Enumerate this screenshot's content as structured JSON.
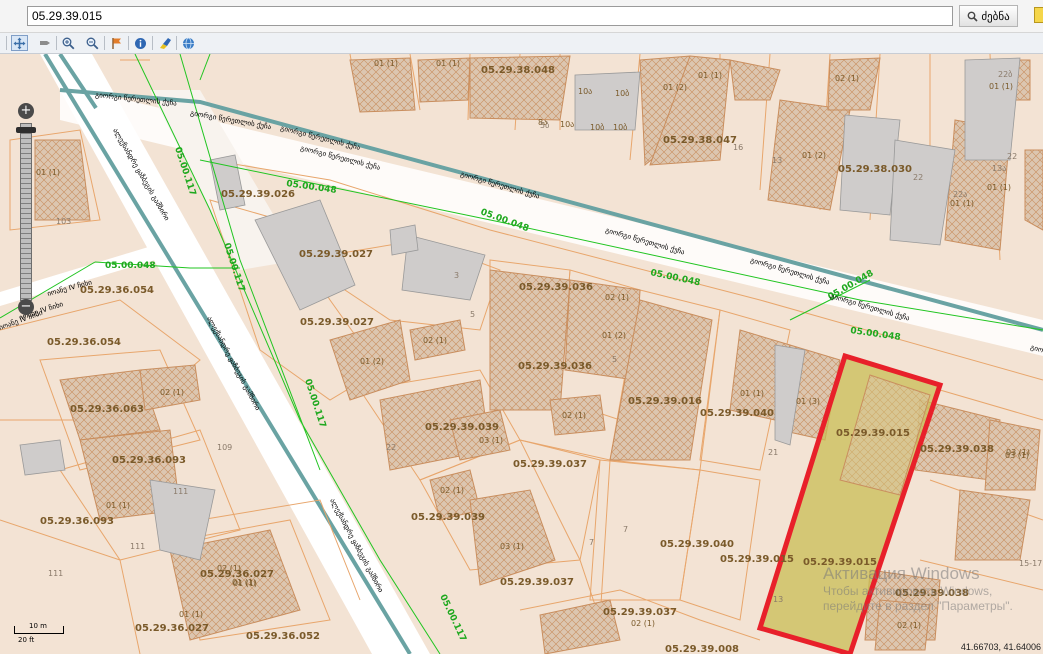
{
  "search": {
    "value": "05.29.39.015",
    "button_label": "ძებნა"
  },
  "map": {
    "parcels": [
      "05.29.38.048",
      "05.29.38.047",
      "05.29.38.030",
      "05.29.39.026",
      "05.29.39.027",
      "05.29.39.027",
      "05.29.39.036",
      "05.29.39.036",
      "05.29.39.016",
      "05.29.39.040",
      "05.29.39.015",
      "05.29.39.038",
      "05.29.39.039",
      "05.29.39.039",
      "05.29.39.037",
      "05.29.39.037",
      "05.29.39.040",
      "05.29.39.015",
      "05.29.39.015",
      "05.29.39.038",
      "05.29.39.037",
      "05.29.39.008",
      "05.29.36.054",
      "05.29.36.054",
      "05.29.36.063",
      "05.29.36.093",
      "05.29.36.093",
      "05.29.36.027",
      "05.29.36.027",
      "05.29.36.052"
    ],
    "buildings": [
      "01 (1)",
      "01 (1)",
      "10ა",
      "10ბ",
      "10ბ",
      "10ბ",
      "8ა",
      "10ა",
      "01 (2)",
      "01 (1)",
      "02 (1)",
      "01 (2)",
      "01 (1)",
      "01 (1)",
      "01 (1)",
      "01 (1)",
      "02 (1)",
      "01 (2)",
      "01 (2)",
      "02 (1)",
      "03 (1)",
      "02 (1)",
      "03 (1)",
      "01 (1)",
      "01 (3)",
      "03 (1)",
      "02 (1)",
      "01 (1)",
      "02 (1)",
      "01 (1)",
      "01 (1)",
      "01 (1)",
      "02 (1)",
      "02 (1)",
      "03 (1)",
      "02 (1)"
    ],
    "house_numbers": [
      "16",
      "13",
      "22",
      "22",
      "22ა",
      "22ბ",
      "103",
      "3",
      "5",
      "5",
      "7",
      "7",
      "13",
      "21",
      "22",
      "109",
      "111",
      "111",
      "111",
      "15-17",
      "5ბ",
      "13ა"
    ],
    "green_labels": [
      "05.00.117",
      "05.00.048",
      "05.00.048",
      "05.00.117",
      "05.00.048",
      "05.00.048",
      "05.00.048",
      "05.00.048",
      "05.00.117",
      "05.00.117"
    ],
    "street_labels": [
      "გიორგი წერეთლის ქუჩა",
      "გიორგი წერეთლის ქუჩა",
      "გიორგი წერეთლის ქუჩა",
      "გიორგი წერეთლის ქუჩა",
      "გიორგი წერეთლის ქუჩა",
      "გიორგი წერეთლის ქუჩა",
      "გიორგი წერეთლის ქუჩა",
      "გიორგი წერეთლის ქუჩა",
      "გიორგი წერეთლის ქუჩა",
      "ალექსანდრე ყაზბეგის გამზირი",
      "ალექსანდრე ყაზბეგის გამზირი",
      "ალექსანდრე ყაზბეგის გამზირი",
      "იოანე IV ჩიხი",
      "იოანე IV ჩიხი",
      "იოანე IV ჩიხი"
    ]
  },
  "scale": {
    "top": "10 m",
    "bottom": "20 ft"
  },
  "coords": "41.66703, 41.64006",
  "watermark": {
    "title": "Активация Windows",
    "subtitle": "Чтобы активировать Windows, перейдите в раздел \"Параметры\"."
  },
  "colors": {
    "parcel_line": "#e8a66c",
    "road": "#ffffff",
    "green_line": "#21c521",
    "highlight_stroke": "#e8202a",
    "highlight_fill": "#c9bd55",
    "cadastre_line": "#6aa3a3"
  },
  "icons": [
    "pan-icon",
    "hand-icon",
    "zoom-in-icon",
    "zoom-out-icon",
    "flag-icon",
    "info-icon",
    "highlighter-icon",
    "globe-icon",
    "search-icon",
    "zoom-plus-icon",
    "zoom-minus-icon"
  ]
}
